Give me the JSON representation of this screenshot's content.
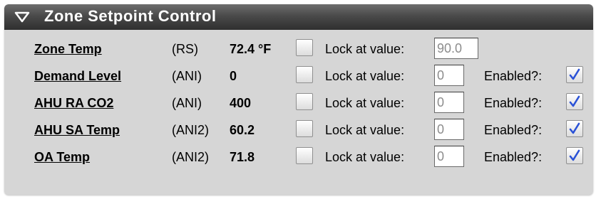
{
  "panel": {
    "title": "Zone Setpoint Control",
    "collapse_icon": "triangle-down-icon"
  },
  "labels": {
    "lock": "Lock at value:",
    "enabled": "Enabled?:"
  },
  "rows": [
    {
      "name": "Zone Temp",
      "type": "(RS)",
      "value": "72.4 °F",
      "lock_checked": false,
      "lock_value": "90.0",
      "has_enabled": false
    },
    {
      "name": "Demand Level",
      "type": "(ANI)",
      "value": "0",
      "lock_checked": false,
      "lock_value": "0",
      "has_enabled": true,
      "enabled": true
    },
    {
      "name": "AHU RA CO2",
      "type": "(ANI)",
      "value": "400",
      "lock_checked": false,
      "lock_value": "0",
      "has_enabled": true,
      "enabled": true
    },
    {
      "name": "AHU SA Temp",
      "type": "(ANI2)",
      "value": "60.2",
      "lock_checked": false,
      "lock_value": "0",
      "has_enabled": true,
      "enabled": true
    },
    {
      "name": "OA Temp",
      "type": "(ANI2)",
      "value": "71.8",
      "lock_checked": false,
      "lock_value": "0",
      "has_enabled": true,
      "enabled": true
    }
  ],
  "colors": {
    "header_top": "#6e6e6e",
    "header_bottom": "#2f2f2f",
    "panel_bg": "#d6d6d6",
    "check_mark": "#2b52d6",
    "input_text": "#8c8c8c"
  }
}
